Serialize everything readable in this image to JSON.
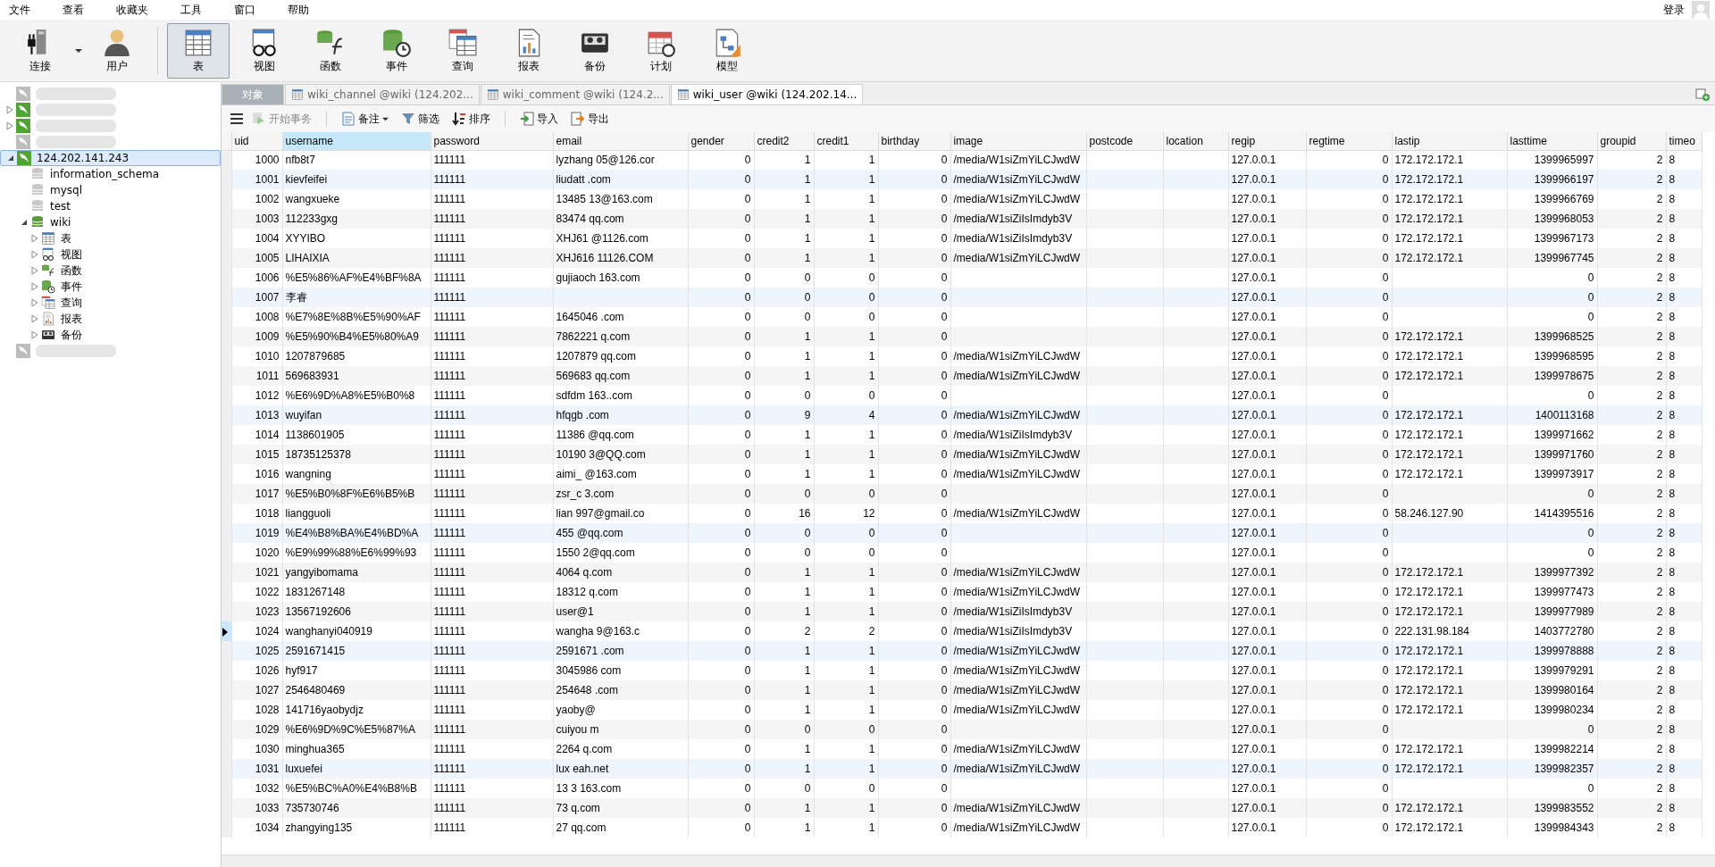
{
  "menu": [
    "文件",
    "查看",
    "收藏夹",
    "工具",
    "窗口",
    "帮助"
  ],
  "login": "登录",
  "toolbar": [
    {
      "label": "连接",
      "kind": "connect",
      "selected": false
    },
    {
      "label": "用户",
      "kind": "user",
      "selected": false
    },
    {
      "label": "表",
      "kind": "table",
      "selected": true
    },
    {
      "label": "视图",
      "kind": "view",
      "selected": false
    },
    {
      "label": "函数",
      "kind": "function",
      "selected": false
    },
    {
      "label": "事件",
      "kind": "event",
      "selected": false
    },
    {
      "label": "查询",
      "kind": "query",
      "selected": false
    },
    {
      "label": "报表",
      "kind": "report",
      "selected": false
    },
    {
      "label": "备份",
      "kind": "backup",
      "selected": false
    },
    {
      "label": "计划",
      "kind": "schedule",
      "selected": false
    },
    {
      "label": "模型",
      "kind": "model",
      "selected": false
    }
  ],
  "sidebar": {
    "items": [
      {
        "active": false,
        "selected": false
      },
      {
        "active": true,
        "expanded": false,
        "selected": false
      },
      {
        "active": true,
        "expanded": false,
        "selected": false
      },
      {
        "active": false,
        "selected": false
      },
      {
        "name": "124.202.141.243",
        "active": true,
        "expanded": true,
        "selected": true,
        "children": [
          {
            "name": "information_schema",
            "kind": "database",
            "active": false
          },
          {
            "name": "mysql",
            "kind": "database",
            "active": false
          },
          {
            "name": "test",
            "kind": "database",
            "active": false
          },
          {
            "name": "wiki",
            "kind": "database",
            "active": true,
            "expanded": true,
            "children": [
              {
                "name": "表",
                "kind": "table",
                "expanded": false
              },
              {
                "name": "视图",
                "kind": "view",
                "expanded": false
              },
              {
                "name": "函数",
                "kind": "function",
                "expanded": false
              },
              {
                "name": "事件",
                "kind": "event",
                "expanded": false
              },
              {
                "name": "查询",
                "kind": "query",
                "expanded": false
              },
              {
                "name": "报表",
                "kind": "report",
                "expanded": false
              },
              {
                "name": "备份",
                "kind": "backup",
                "expanded": false
              }
            ]
          }
        ]
      },
      {
        "active": false,
        "selected": false
      }
    ]
  },
  "tabs": [
    {
      "label": "对象",
      "kind": "objects",
      "selected": false
    },
    {
      "label": "wiki_channel @wiki (124.202...",
      "kind": "table",
      "selected": false
    },
    {
      "label": "wiki_comment @wiki (124.2...",
      "kind": "table",
      "selected": false
    },
    {
      "label": "wiki_user @wiki (124.202.14...",
      "kind": "table",
      "selected": true
    }
  ],
  "actions": [
    {
      "label": "开始事务",
      "kind": "transaction",
      "disabled": true,
      "dropdown": false
    },
    {
      "label": "备注",
      "kind": "memo",
      "disabled": false,
      "dropdown": true
    },
    {
      "label": "筛选",
      "kind": "filter",
      "disabled": false,
      "dropdown": false
    },
    {
      "label": "排序",
      "kind": "sort",
      "disabled": false,
      "dropdown": false
    },
    {
      "label": "导入",
      "kind": "import",
      "disabled": false,
      "dropdown": false
    },
    {
      "label": "导出",
      "kind": "export",
      "disabled": false,
      "dropdown": false
    }
  ],
  "table": {
    "columns": [
      {
        "label": "uid",
        "selected": false
      },
      {
        "label": "username",
        "selected": true
      },
      {
        "label": "password",
        "selected": false
      },
      {
        "label": "email",
        "selected": false
      },
      {
        "label": "gender",
        "selected": false
      },
      {
        "label": "credit2",
        "selected": false
      },
      {
        "label": "credit1",
        "selected": false
      },
      {
        "label": "birthday",
        "selected": false
      },
      {
        "label": "image",
        "selected": false
      },
      {
        "label": "postcode",
        "selected": false
      },
      {
        "label": "location",
        "selected": false
      },
      {
        "label": "regip",
        "selected": false
      },
      {
        "label": "regtime",
        "selected": false
      },
      {
        "label": "lastip",
        "selected": false
      },
      {
        "label": "lasttime",
        "selected": false
      },
      {
        "label": "groupid",
        "selected": false
      },
      {
        "label": "timeo",
        "selected": false
      }
    ],
    "rows": [
      {
        "selected": false,
        "cells": [
          "1000",
          "nfb8t7",
          "111111",
          "lyzhang 05@126.cor",
          "0",
          "1",
          "1",
          "0",
          "/media/W1siZmYiLCJwdW",
          "",
          "",
          "127.0.0.1",
          "0",
          "172.172.172.1",
          "1399965997",
          "2",
          "8"
        ]
      },
      {
        "selected": false,
        "cells": [
          "1001",
          "kievfeifei",
          "111111",
          "liudatt .com",
          "0",
          "1",
          "1",
          "0",
          "/media/W1siZmYiLCJwdW",
          "",
          "",
          "127.0.0.1",
          "0",
          "172.172.172.1",
          "1399966197",
          "2",
          "8"
        ]
      },
      {
        "selected": false,
        "cells": [
          "1002",
          "wangxueke",
          "111111",
          "13485 13@163.com",
          "0",
          "1",
          "1",
          "0",
          "/media/W1siZmYiLCJwdW",
          "",
          "",
          "127.0.0.1",
          "0",
          "172.172.172.1",
          "1399966769",
          "2",
          "8"
        ]
      },
      {
        "selected": false,
        "cells": [
          "1003",
          "112233gxg",
          "111111",
          "83474 qq.com",
          "0",
          "1",
          "1",
          "0",
          "/media/W1siZiIsImdyb3V",
          "",
          "",
          "127.0.0.1",
          "0",
          "172.172.172.1",
          "1399968053",
          "2",
          "8"
        ]
      },
      {
        "selected": false,
        "cells": [
          "1004",
          "XYYIBO",
          "111111",
          "XHJ61 @1126.com",
          "0",
          "1",
          "1",
          "0",
          "/media/W1siZiIsImdyb3V",
          "",
          "",
          "127.0.0.1",
          "0",
          "172.172.172.1",
          "1399967173",
          "2",
          "8"
        ]
      },
      {
        "selected": false,
        "cells": [
          "1005",
          "LIHAIXIA",
          "111111",
          "XHJ616 11126.COM",
          "0",
          "1",
          "1",
          "0",
          "/media/W1siZmYiLCJwdW",
          "",
          "",
          "127.0.0.1",
          "0",
          "172.172.172.1",
          "1399967745",
          "2",
          "8"
        ]
      },
      {
        "selected": false,
        "cells": [
          "1006",
          "%E5%86%AF%E4%BF%8A",
          "111111",
          "gujiaoch 163.com",
          "0",
          "0",
          "0",
          "0",
          "",
          "",
          "",
          "127.0.0.1",
          "0",
          "",
          "0",
          "2",
          "8"
        ]
      },
      {
        "selected": false,
        "cells": [
          "1007",
          "李睿",
          "111111",
          "",
          "0",
          "0",
          "0",
          "0",
          "",
          "",
          "",
          "127.0.0.1",
          "0",
          "",
          "0",
          "2",
          "8"
        ]
      },
      {
        "selected": false,
        "cells": [
          "1008",
          "%E7%8E%8B%E5%90%AF",
          "111111",
          "1645046 .com",
          "0",
          "0",
          "0",
          "0",
          "",
          "",
          "",
          "127.0.0.1",
          "0",
          "",
          "0",
          "2",
          "8"
        ]
      },
      {
        "selected": false,
        "cells": [
          "1009",
          "%E5%90%B4%E5%80%A9",
          "111111",
          "7862221 q.com",
          "0",
          "1",
          "1",
          "0",
          "",
          "",
          "",
          "127.0.0.1",
          "0",
          "172.172.172.1",
          "1399968525",
          "2",
          "8"
        ]
      },
      {
        "selected": false,
        "cells": [
          "1010",
          "1207879685",
          "111111",
          "1207879 qq.com",
          "0",
          "1",
          "1",
          "0",
          "/media/W1siZmYiLCJwdW",
          "",
          "",
          "127.0.0.1",
          "0",
          "172.172.172.1",
          "1399968595",
          "2",
          "8"
        ]
      },
      {
        "selected": false,
        "cells": [
          "1011",
          "569683931",
          "111111",
          "569683 qq.com",
          "0",
          "1",
          "1",
          "0",
          "/media/W1siZmYiLCJwdW",
          "",
          "",
          "127.0.0.1",
          "0",
          "172.172.172.1",
          "1399978675",
          "2",
          "8"
        ]
      },
      {
        "selected": false,
        "cells": [
          "1012",
          "%E6%9D%A8%E5%B0%8",
          "111111",
          "sdfdm 163..com",
          "0",
          "0",
          "0",
          "0",
          "",
          "",
          "",
          "127.0.0.1",
          "0",
          "",
          "0",
          "2",
          "8"
        ]
      },
      {
        "selected": false,
        "cells": [
          "1013",
          "wuyifan",
          "111111",
          "hfqgb .com",
          "0",
          "9",
          "4",
          "0",
          "/media/W1siZmYiLCJwdW",
          "",
          "",
          "127.0.0.1",
          "0",
          "172.172.172.1",
          "1400113168",
          "2",
          "8"
        ]
      },
      {
        "selected": false,
        "cells": [
          "1014",
          "1138601905",
          "111111",
          "11386 @qq.com",
          "0",
          "1",
          "1",
          "0",
          "/media/W1siZiIsImdyb3V",
          "",
          "",
          "127.0.0.1",
          "0",
          "172.172.172.1",
          "1399971662",
          "2",
          "8"
        ]
      },
      {
        "selected": false,
        "cells": [
          "1015",
          "18735125378",
          "111111",
          "10190 3@QQ.com",
          "0",
          "1",
          "1",
          "0",
          "/media/W1siZmYiLCJwdW",
          "",
          "",
          "127.0.0.1",
          "0",
          "172.172.172.1",
          "1399971760",
          "2",
          "8"
        ]
      },
      {
        "selected": false,
        "cells": [
          "1016",
          "wangning",
          "111111",
          "aimi_ @163.com",
          "0",
          "1",
          "1",
          "0",
          "/media/W1siZmYiLCJwdW",
          "",
          "",
          "127.0.0.1",
          "0",
          "172.172.172.1",
          "1399973917",
          "2",
          "8"
        ]
      },
      {
        "selected": false,
        "cells": [
          "1017",
          "%E5%B0%8F%E6%B5%B",
          "111111",
          "zsr_c 3.com",
          "0",
          "0",
          "0",
          "0",
          "",
          "",
          "",
          "127.0.0.1",
          "0",
          "",
          "0",
          "2",
          "8"
        ]
      },
      {
        "selected": false,
        "cells": [
          "1018",
          "liangguoli",
          "111111",
          "lian 997@gmail.co",
          "0",
          "16",
          "12",
          "0",
          "/media/W1siZmYiLCJwdW",
          "",
          "",
          "127.0.0.1",
          "0",
          "58.246.127.90",
          "1414395516",
          "2",
          "8"
        ]
      },
      {
        "selected": false,
        "cells": [
          "1019",
          "%E4%B8%BA%E4%BD%A",
          "111111",
          "455 @qq.com",
          "0",
          "0",
          "0",
          "0",
          "",
          "",
          "",
          "127.0.0.1",
          "0",
          "",
          "0",
          "2",
          "8"
        ]
      },
      {
        "selected": false,
        "cells": [
          "1020",
          "%E9%99%88%E6%99%93",
          "111111",
          "1550 2@qq.com",
          "0",
          "0",
          "0",
          "0",
          "",
          "",
          "",
          "127.0.0.1",
          "0",
          "",
          "0",
          "2",
          "8"
        ]
      },
      {
        "selected": false,
        "cells": [
          "1021",
          "yangyibomama",
          "111111",
          "4064 q.com",
          "0",
          "1",
          "1",
          "0",
          "/media/W1siZmYiLCJwdW",
          "",
          "",
          "127.0.0.1",
          "0",
          "172.172.172.1",
          "1399977392",
          "2",
          "8"
        ]
      },
      {
        "selected": false,
        "cells": [
          "1022",
          "1831267148",
          "111111",
          "18312 q.com",
          "0",
          "1",
          "1",
          "0",
          "/media/W1siZmYiLCJwdW",
          "",
          "",
          "127.0.0.1",
          "0",
          "172.172.172.1",
          "1399977473",
          "2",
          "8"
        ]
      },
      {
        "selected": false,
        "cells": [
          "1023",
          "13567192606",
          "111111",
          "user@1",
          "0",
          "1",
          "1",
          "0",
          "/media/W1siZiIsImdyb3V",
          "",
          "",
          "127.0.0.1",
          "0",
          "172.172.172.1",
          "1399977989",
          "2",
          "8"
        ]
      },
      {
        "selected": true,
        "cells": [
          "1024",
          "wanghanyi040919",
          "111111",
          "wangha 9@163.c",
          "0",
          "2",
          "2",
          "0",
          "/media/W1siZiIsImdyb3V",
          "",
          "",
          "127.0.0.1",
          "0",
          "222.131.98.184",
          "1403772780",
          "2",
          "8"
        ]
      },
      {
        "selected": false,
        "cells": [
          "1025",
          "2591671415",
          "111111",
          "2591671 .com",
          "0",
          "1",
          "1",
          "0",
          "/media/W1siZmYiLCJwdW",
          "",
          "",
          "127.0.0.1",
          "0",
          "172.172.172.1",
          "1399978888",
          "2",
          "8"
        ]
      },
      {
        "selected": false,
        "cells": [
          "1026",
          "hyf917",
          "111111",
          "3045986 com",
          "0",
          "1",
          "1",
          "0",
          "/media/W1siZmYiLCJwdW",
          "",
          "",
          "127.0.0.1",
          "0",
          "172.172.172.1",
          "1399979291",
          "2",
          "8"
        ]
      },
      {
        "selected": false,
        "cells": [
          "1027",
          "2546480469",
          "111111",
          "254648 .com",
          "0",
          "1",
          "1",
          "0",
          "/media/W1siZmYiLCJwdW",
          "",
          "",
          "127.0.0.1",
          "0",
          "172.172.172.1",
          "1399980164",
          "2",
          "8"
        ]
      },
      {
        "selected": false,
        "cells": [
          "1028",
          "141716yaobydjz",
          "111111",
          "yaoby@",
          "0",
          "1",
          "1",
          "0",
          "/media/W1siZmYiLCJwdW",
          "",
          "",
          "127.0.0.1",
          "0",
          "172.172.172.1",
          "1399980234",
          "2",
          "8"
        ]
      },
      {
        "selected": false,
        "cells": [
          "1029",
          "%E6%9D%9C%E5%87%A",
          "111111",
          "cuiyou m",
          "0",
          "0",
          "0",
          "0",
          "",
          "",
          "",
          "127.0.0.1",
          "0",
          "",
          "0",
          "2",
          "8"
        ]
      },
      {
        "selected": false,
        "cells": [
          "1030",
          "minghua365",
          "111111",
          "2264 q.com",
          "0",
          "1",
          "1",
          "0",
          "/media/W1siZmYiLCJwdW",
          "",
          "",
          "127.0.0.1",
          "0",
          "172.172.172.1",
          "1399982214",
          "2",
          "8"
        ]
      },
      {
        "selected": false,
        "cells": [
          "1031",
          "luxuefei",
          "111111",
          "lux eah.net",
          "0",
          "1",
          "1",
          "0",
          "/media/W1siZmYiLCJwdW",
          "",
          "",
          "127.0.0.1",
          "0",
          "172.172.172.1",
          "1399982357",
          "2",
          "8"
        ]
      },
      {
        "selected": false,
        "cells": [
          "1032",
          "%E5%BC%A0%E4%B8%B",
          "111111",
          "13 3 163.com",
          "0",
          "0",
          "0",
          "0",
          "",
          "",
          "",
          "127.0.0.1",
          "0",
          "",
          "0",
          "2",
          "8"
        ]
      },
      {
        "selected": false,
        "cells": [
          "1033",
          "735730746",
          "111111",
          "73 q.com",
          "0",
          "1",
          "1",
          "0",
          "/media/W1siZmYiLCJwdW",
          "",
          "",
          "127.0.0.1",
          "0",
          "172.172.172.1",
          "1399983552",
          "2",
          "8"
        ]
      },
      {
        "selected": false,
        "cells": [
          "1034",
          "zhangying135",
          "111111",
          "27 qq.com",
          "0",
          "1",
          "1",
          "0",
          "/media/W1siZmYiLCJwdW",
          "",
          "",
          "127.0.0.1",
          "0",
          "172.172.172.1",
          "1399984343",
          "2",
          "8"
        ]
      }
    ]
  }
}
